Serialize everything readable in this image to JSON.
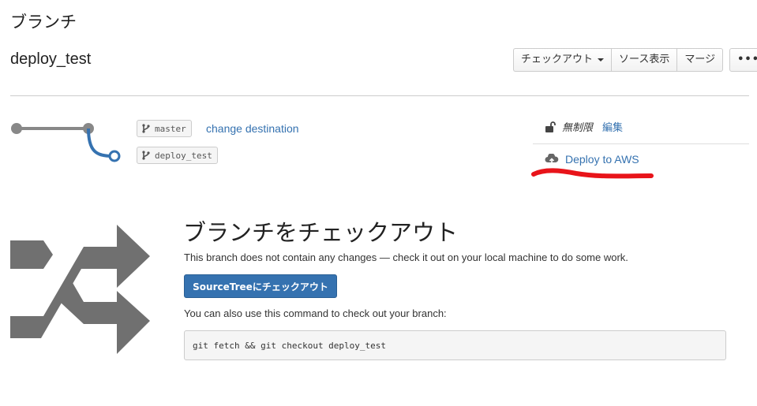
{
  "page": {
    "heading": "ブランチ"
  },
  "branch": {
    "name": "deploy_test"
  },
  "toolbar": {
    "checkout_label": "チェックアウト",
    "source_label": "ソース表示",
    "merge_label": "マージ",
    "more_label": "•••"
  },
  "graph": {
    "source_branch": "master",
    "target_branch": "deploy_test",
    "change_destination": "change destination"
  },
  "sidebar": {
    "permission_icon": "unlock-icon",
    "permission_label": "無制限",
    "edit_label": "編集",
    "deploy_icon": "cloud-upload-icon",
    "deploy_label": "Deploy to AWS"
  },
  "checkout_section": {
    "heading": "ブランチをチェックアウト",
    "description": "This branch does not contain any changes — check it out on your local machine to do some work.",
    "sourcetree_button": "SourceTreeにチェックアウト",
    "also_text": "You can also use this command to check out your branch:",
    "command": "git fetch && git checkout deploy_test"
  },
  "colors": {
    "link": "#3572b0",
    "primary_button": "#3572b0",
    "graph_line": "#888888",
    "graph_branch": "#3572b0",
    "annotation": "#e8141a"
  }
}
